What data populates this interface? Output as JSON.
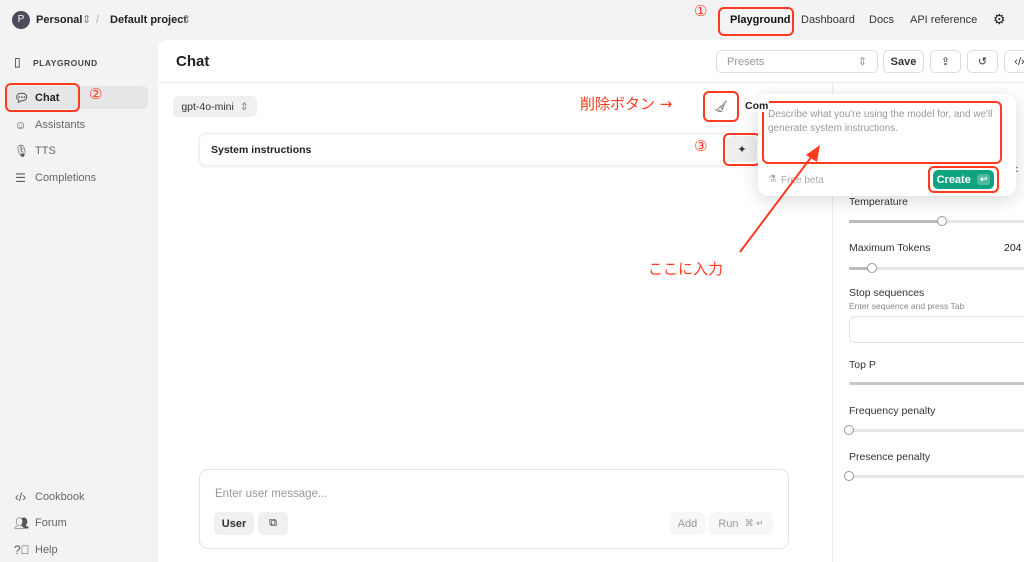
{
  "topbar": {
    "avatar": "P",
    "org": "Personal",
    "separator": "/",
    "project": "Default project",
    "nav": [
      "Playground",
      "Dashboard",
      "Docs",
      "API reference"
    ]
  },
  "sidebar": {
    "title": "PLAYGROUND",
    "items": [
      {
        "label": "Chat",
        "icon": "chat-bubble-icon"
      },
      {
        "label": "Assistants",
        "icon": "robot-icon"
      },
      {
        "label": "TTS",
        "icon": "microphone-icon"
      },
      {
        "label": "Completions",
        "icon": "lines-icon"
      }
    ],
    "bottom": [
      {
        "label": "Cookbook",
        "icon": "code-icon"
      },
      {
        "label": "Forum",
        "icon": "people-icon"
      },
      {
        "label": "Help",
        "icon": "help-icon"
      }
    ]
  },
  "header": {
    "title": "Chat",
    "presets_placeholder": "Presets",
    "save": "Save"
  },
  "chat": {
    "model": "gpt-4o-mini",
    "system_label": "System instructions",
    "comp_label": "Com",
    "message_placeholder": "Enter user message...",
    "role": "User",
    "add": "Add",
    "run": "Run",
    "run_shortcut": "⌘ ↵"
  },
  "popover": {
    "placeholder": "Describe what you're using the model for, and we'll generate system instructions.",
    "beta": "Free beta",
    "create": "Create"
  },
  "settings": {
    "text_fragment": "ext",
    "temperature": "Temperature",
    "temperature_value": 0.53,
    "max_tokens": "Maximum Tokens",
    "max_tokens_value": "204",
    "max_tokens_fraction": 0.13,
    "stop": "Stop sequences",
    "stop_hint": "Enter sequence and press Tab",
    "top_p": "Top P",
    "top_p_value": 1,
    "frequency": "Frequency penalty",
    "frequency_value": 0,
    "presence": "Presence penalty",
    "presence_value": 0
  },
  "annotations": {
    "n1": "①",
    "n2": "②",
    "n3": "③",
    "delete": "削除ボタン →",
    "input_here": "ここに入力",
    "color": "#ff3b1f"
  },
  "colors": {
    "accent": "#10a37f"
  }
}
